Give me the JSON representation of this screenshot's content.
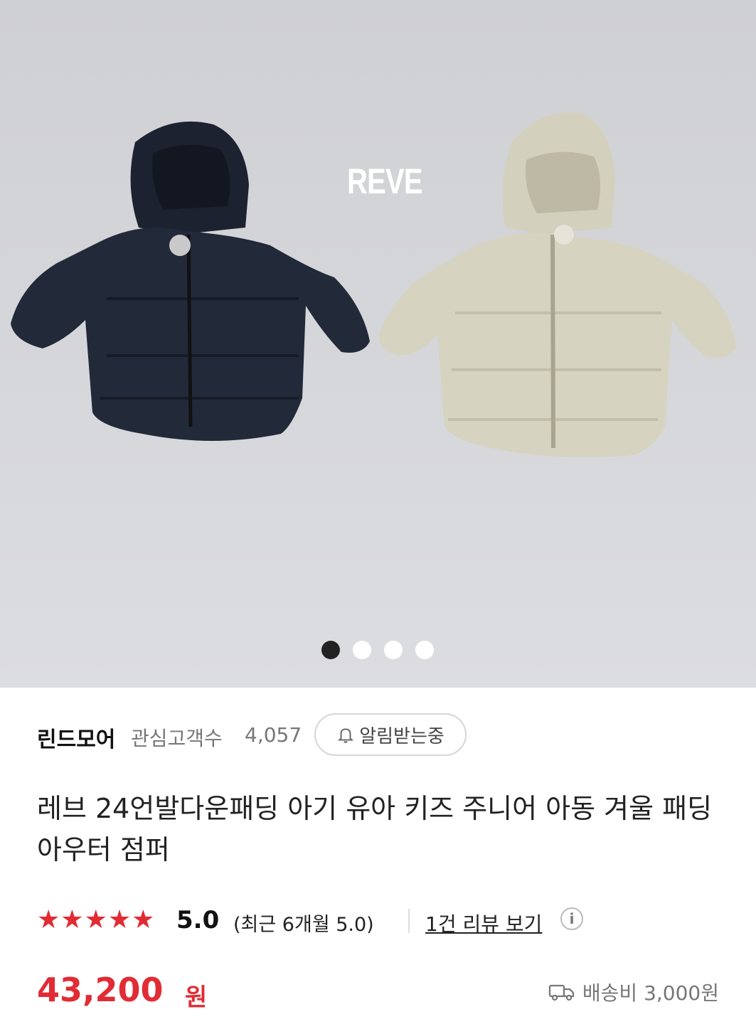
{
  "hero": {
    "brand_mark": "REVE",
    "carousel": {
      "total": 4,
      "active_index": 0
    }
  },
  "store": {
    "name": "린드모어",
    "followers_label": "관심고객수",
    "followers_count": "4,057",
    "alert_button": "알림받는중"
  },
  "product": {
    "title": "레브 24언발다운패딩 아기 유아 키즈 주니어 아동 겨울 패딩 아우터 점퍼",
    "rating": {
      "stars": 5,
      "score": "5.0",
      "recent": "(최근 6개월 5.0)",
      "review_link": "1건 리뷰 보기",
      "info_icon": "i"
    },
    "price": "43,200",
    "currency": "원",
    "shipping": "배송비 3,000원"
  },
  "colors": {
    "accent": "#e12c35",
    "navy_jacket": "#1f2533",
    "beige_jacket": "#cfccb8"
  },
  "icons": [
    "bell-icon",
    "truck-icon",
    "info-icon",
    "star-icon"
  ]
}
